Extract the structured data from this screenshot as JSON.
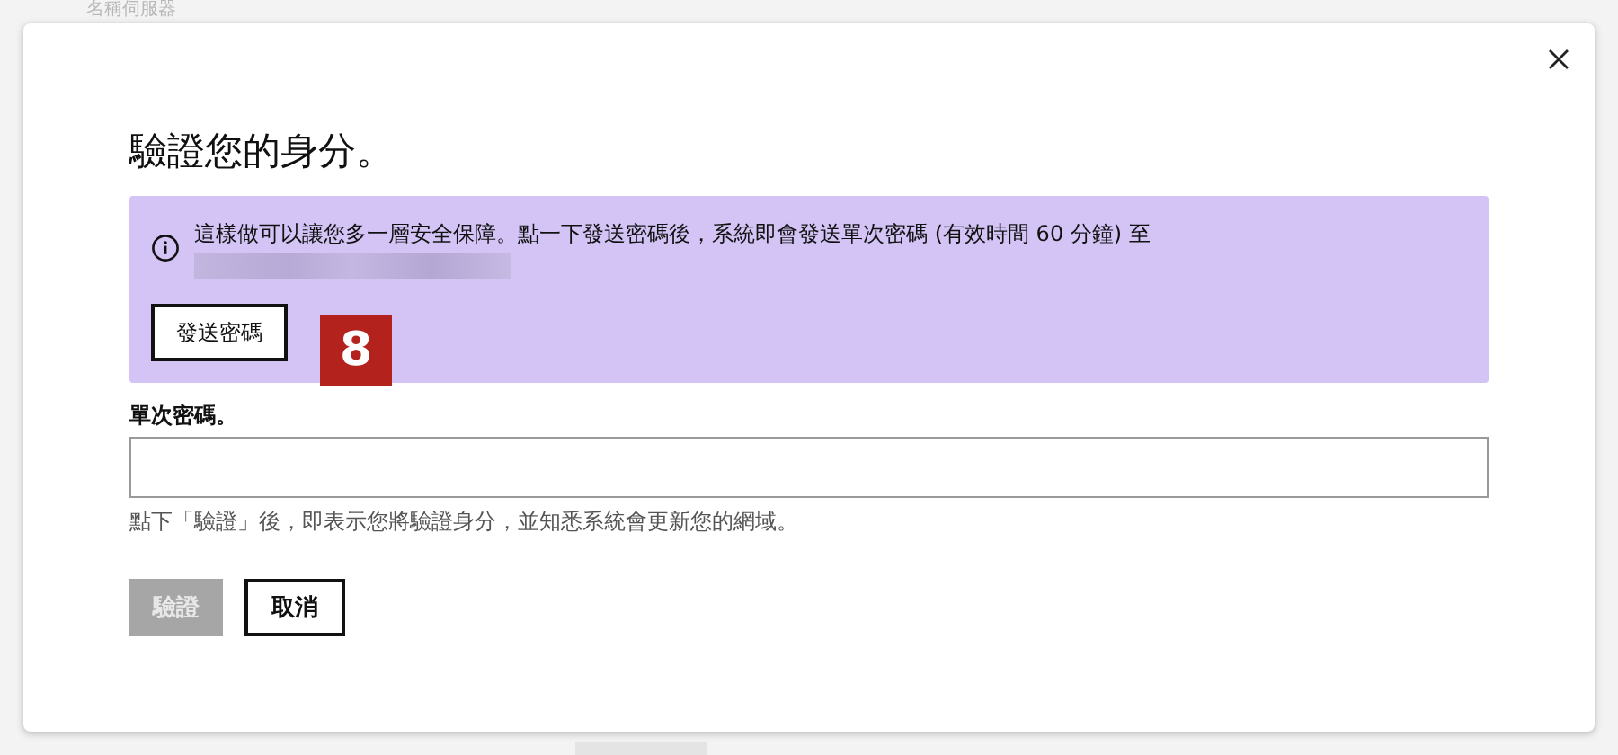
{
  "background": {
    "heading": "名稱伺服器"
  },
  "dialog": {
    "title": "驗證您的身分。",
    "notice": {
      "text": "這樣做可以讓您多一層安全保障。點一下發送密碼後，系統即會發送單次密碼 (有效時間 60 分鐘) 至",
      "send_button": "發送密碼"
    },
    "badge": "8",
    "field": {
      "label": "單次密碼。"
    },
    "hint": "點下「驗證」後，即表示您將驗證身分，並知悉系統會更新您的網域。",
    "buttons": [
      {
        "label": "驗證",
        "kind": "primary",
        "disabled": true
      },
      {
        "label": "取消",
        "kind": "secondary",
        "disabled": false
      }
    ]
  }
}
